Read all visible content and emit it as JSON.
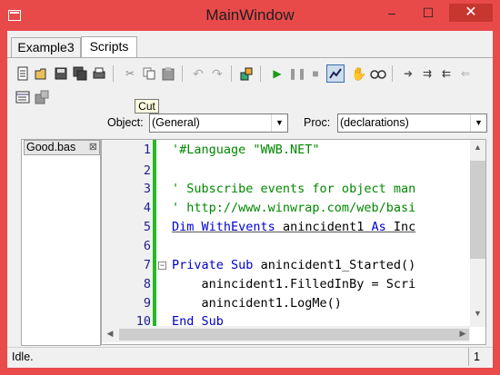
{
  "window": {
    "title": "MainWindow",
    "minimize": "–",
    "maximize": "☐",
    "close": "✕"
  },
  "tabs": [
    {
      "label": "Example3"
    },
    {
      "label": "Scripts"
    }
  ],
  "tooltip": "Cut",
  "toolbar": {
    "icons": [
      "new-icon",
      "open-icon",
      "save-icon",
      "save-all-icon",
      "print-icon",
      "cut-icon",
      "copy-icon",
      "paste-icon",
      "undo-icon",
      "redo-icon",
      "macro-icon",
      "run-icon",
      "pause-icon",
      "stop-icon",
      "debug-icon",
      "hand-icon",
      "watch-icon",
      "step-into-icon",
      "step-over-icon",
      "step-out-icon",
      "step-return-icon",
      "properties-icon",
      "references-icon"
    ]
  },
  "object": {
    "label": "Object:",
    "value": "(General)"
  },
  "proc": {
    "label": "Proc:",
    "value": "(declarations)"
  },
  "files": {
    "tab": "Good.bas",
    "close": "⊠"
  },
  "editor": {
    "line_numbers": [
      "1",
      "2",
      "3",
      "4",
      "5",
      "6",
      "7",
      "8",
      "9",
      "10"
    ]
  },
  "status": {
    "text": "Idle.",
    "number": "1"
  }
}
